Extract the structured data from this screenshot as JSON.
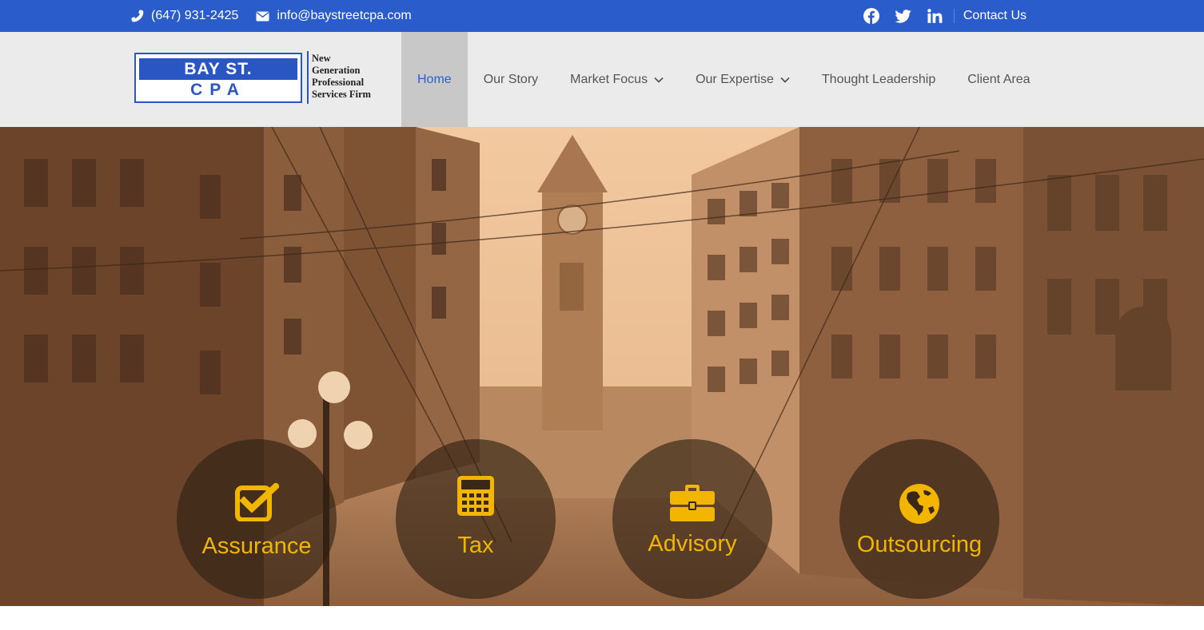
{
  "topbar": {
    "phone": "(647) 931-2425",
    "email": "info@baystreetcpa.com",
    "social": [
      "facebook-icon",
      "twitter-icon",
      "linkedin-icon"
    ],
    "contact_link": "Contact Us"
  },
  "logo": {
    "line1": "BAY ST.",
    "line2": "CPA",
    "tagline": [
      "New",
      "Generation",
      "Professional",
      "Services Firm"
    ]
  },
  "nav": {
    "items": [
      {
        "label": "Home",
        "active": true
      },
      {
        "label": "Our Story"
      },
      {
        "label": "Market Focus",
        "dropdown": true
      },
      {
        "label": "Our Expertise",
        "dropdown": true
      },
      {
        "label": "Thought Leadership"
      },
      {
        "label": "Client Area"
      }
    ]
  },
  "hero": {
    "services": [
      {
        "label": "Assurance",
        "icon": "checkbox-icon"
      },
      {
        "label": "Tax",
        "icon": "calculator-icon"
      },
      {
        "label": "Advisory",
        "icon": "briefcase-icon"
      },
      {
        "label": "Outsourcing",
        "icon": "globe-icon"
      }
    ]
  },
  "colors": {
    "topbar": "#2b5ccc",
    "header": "#ebebeb",
    "nav_active_bg": "#c8c8c8",
    "nav_active_text": "#2d5fd0",
    "service_accent": "#f2b500"
  }
}
